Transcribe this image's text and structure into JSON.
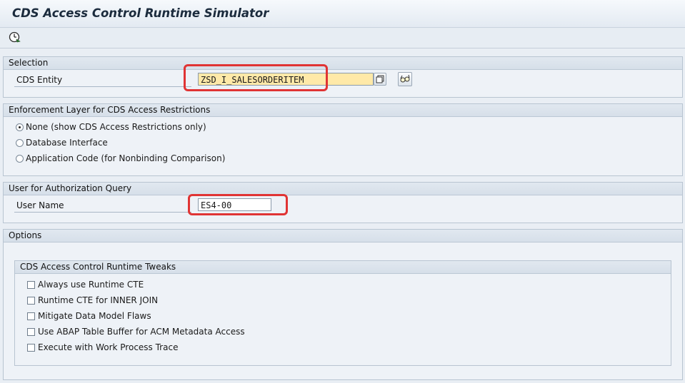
{
  "app": {
    "title": "CDS Access Control Runtime Simulator"
  },
  "toolbar": {
    "execute_icon": "execute-clock-icon"
  },
  "selection": {
    "header": "Selection",
    "cds_entity_label": "CDS Entity",
    "cds_entity_value": "ZSD_I_SALESORDERITEM"
  },
  "enforcement": {
    "header": "Enforcement Layer for CDS Access Restrictions",
    "options": [
      {
        "label": "None (show CDS Access Restrictions only)",
        "selected": true
      },
      {
        "label": "Database Interface",
        "selected": false
      },
      {
        "label": "Application Code (for Nonbinding Comparison)",
        "selected": false
      }
    ]
  },
  "user_query": {
    "header": "User for Authorization Query",
    "user_name_label": "User Name",
    "user_name_value": "ES4-00"
  },
  "options": {
    "header": "Options",
    "tweaks": {
      "header": "CDS Access Control Runtime Tweaks",
      "items": [
        {
          "label": "Always use Runtime CTE",
          "checked": false
        },
        {
          "label": "Runtime CTE for INNER JOIN",
          "checked": false
        },
        {
          "label": "Mitigate Data Model Flaws",
          "checked": false
        },
        {
          "label": "Use ABAP Table Buffer for ACM Metadata Access",
          "checked": false
        },
        {
          "label": "Execute with Work Process Trace",
          "checked": false
        }
      ]
    }
  },
  "colors": {
    "highlight": "#e03434",
    "input_focus": "#ffe9a8",
    "background": "#e9eef4"
  }
}
